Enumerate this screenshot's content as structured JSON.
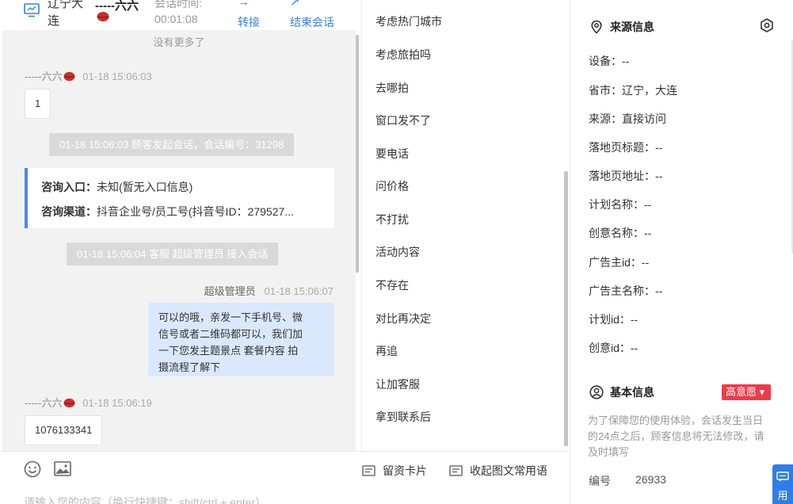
{
  "header": {
    "location": "辽宁大连",
    "nickname": "-----六六",
    "time_label": "会话时间:",
    "time": "00:01:08",
    "transfer_glyph": "→",
    "transfer_label": "转接",
    "end_glyph": "↗",
    "end_label": "结束会话"
  },
  "chat": {
    "no_more": "没有更多了",
    "messages": {
      "m1_nick": "-----六六",
      "m1_time": "01-18 15:06:03",
      "m1_text": "1",
      "sys1": "01-18 15:06:03 顾客发起会话，会话编号：31298",
      "entry_label": "咨询入口：",
      "entry_value": "未知(暂无入口信息)",
      "channel_label": "咨询渠道：",
      "channel_value": "抖音企业号/员工号(抖音号ID：279527...",
      "sys2": "01-18 15:06:04 客服 超级管理员 接入会话",
      "agent_nick": "超级管理员",
      "agent_time": "01-18 15:06:07",
      "agent_line1": "可以的哦，亲发一下手机号、微",
      "agent_line2": "信号或者二维码都可以，我们加",
      "agent_line3": "一下您发主题景点 套餐内容 拍",
      "agent_line4": "摄流程了解下",
      "m2_nick": "-----六六",
      "m2_time": "01-18 15:06:19",
      "m2_text": "1076133341"
    }
  },
  "input": {
    "card_label": "留资卡片",
    "collapse_label": "收起图文常用语",
    "placeholder": "请输入您的内容（换行快捷键：shift/ctrl + enter）"
  },
  "phrases": [
    "考虑热门城市",
    "考虑旅拍吗",
    "去哪拍",
    "窗口发不了",
    "要电话",
    "问价格",
    "不打扰",
    "活动内容",
    "不存在",
    "对比再决定",
    "再追",
    "让加客服",
    "拿到联系后"
  ],
  "source_info": {
    "title": "来源信息",
    "rows": [
      "设备：--",
      "省市：辽宁，大连",
      "来源：直接访问",
      "落地页标题：--",
      "落地页地址：--",
      "计划名称：--",
      "创意名称：--",
      "广告主id：--",
      "广告主名称：--",
      "计划id：--",
      "创意id：--"
    ]
  },
  "basic_info": {
    "title": "基本信息",
    "badge": "高意愿",
    "badge_arrow": "▾",
    "notice": "为了保障您的使用体验，会话发生当日的24点之后，顾客信息将无法修改，请及时填写",
    "serial_label": "编号",
    "serial_value": "26933"
  },
  "float_button": {
    "label": "用"
  },
  "colors": {
    "accent": "#3b7fd9",
    "badge": "#ee3b4a",
    "agent_bubble": "#dae8fd",
    "chat_bg": "#f2f2f2"
  },
  "icons": [
    "monitor-icon",
    "lips-icon",
    "arrow-right-icon",
    "exit-icon",
    "emoji-icon",
    "image-icon",
    "card-icon",
    "collapse-icon",
    "location-pin-icon",
    "hexagon-settings-icon",
    "user-circle-icon",
    "chat-icon"
  ]
}
